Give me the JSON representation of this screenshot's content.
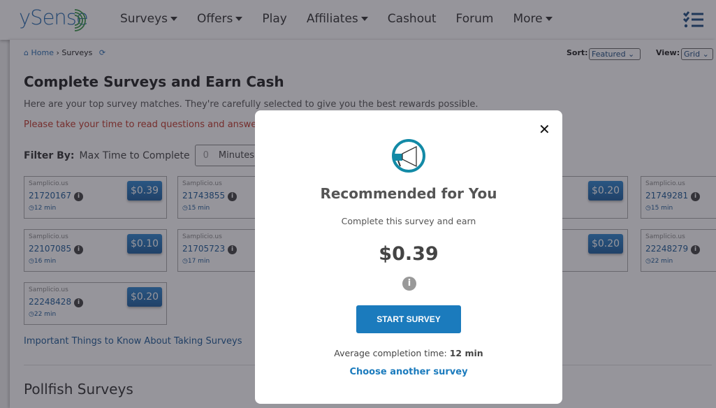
{
  "header": {
    "logo": "ySense",
    "nav": [
      {
        "label": "Surveys",
        "dropdown": true
      },
      {
        "label": "Offers",
        "dropdown": true
      },
      {
        "label": "Play",
        "dropdown": false
      },
      {
        "label": "Affiliates",
        "dropdown": true
      },
      {
        "label": "Cashout",
        "dropdown": false
      },
      {
        "label": "Forum",
        "dropdown": false
      },
      {
        "label": "More",
        "dropdown": true
      }
    ],
    "menu_icon": "checklist-icon"
  },
  "breadcrumb": {
    "home": "Home",
    "sep": "›",
    "current": "Surveys"
  },
  "sort": {
    "label": "Sort:",
    "value": "Featured"
  },
  "view": {
    "label": "View:",
    "value": "Grid"
  },
  "main": {
    "title": "Complete Surveys and Earn Cash",
    "subtitle": "Here are your top survey matches. They're carefully selected to give you the best rewards possible.",
    "warning": "Please take your time to read questions and answer the",
    "filter_label": "Filter By:",
    "filter_text": "Max Time to Complete",
    "filter_value": "0",
    "filter_unit": "Minutes",
    "important_link": "Important Things to Know About Taking Surveys",
    "section2": "Pollfish Surveys"
  },
  "cards": [
    {
      "provider": "Samplicio.us",
      "id": "21720167",
      "time": "12 min",
      "price": "$0.39"
    },
    {
      "provider": "Samplicio.us",
      "id": "21743855",
      "time": "15 min"
    },
    {
      "price": "$0.20"
    },
    {
      "provider": "Samplicio.us",
      "id": "21749281",
      "time": "15 min"
    },
    {
      "provider": "Samplicio.us",
      "id": "22107085",
      "time": "16 min",
      "price": "$0.10"
    },
    {
      "provider": "Samplicio.us",
      "id": "21705723",
      "time": "17 min"
    },
    {
      "price": "$0.20"
    },
    {
      "provider": "Samplicio.us",
      "id": "22248279",
      "time": "22 min"
    },
    {
      "provider": "Samplicio.us",
      "id": "22248428",
      "time": "22 min",
      "price": "$0.20"
    }
  ],
  "modal": {
    "title": "Recommended for You",
    "line": "Complete this survey and earn",
    "price": "$0.39",
    "button": "START SURVEY",
    "avg_label": "Average completion time:",
    "avg_value": "12 min",
    "choose": "Choose another survey",
    "icon": "megaphone-icon",
    "accent": "#1b7bbd"
  }
}
